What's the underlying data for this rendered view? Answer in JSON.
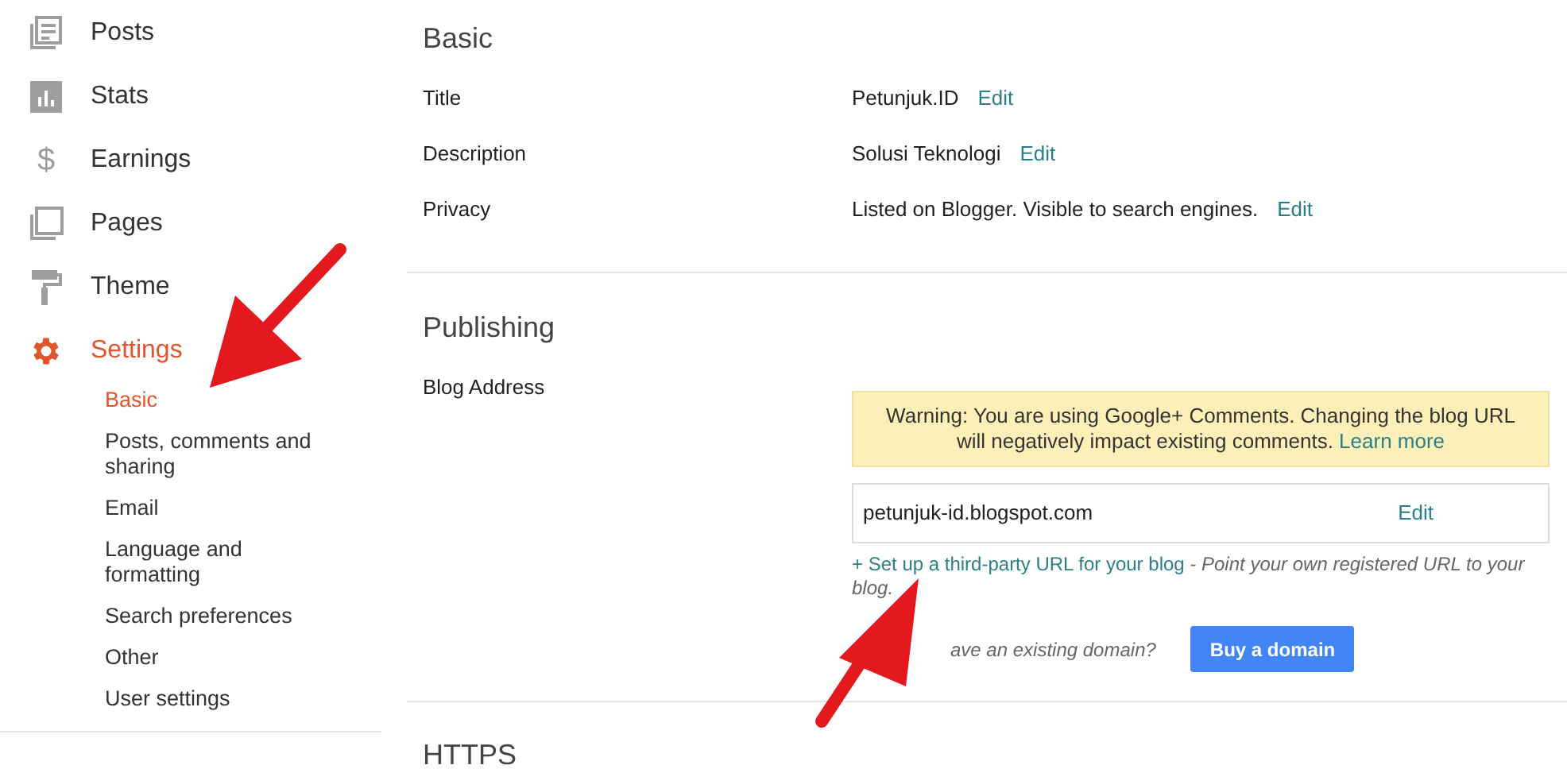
{
  "sidebar": {
    "items": [
      {
        "label": "Posts",
        "kind": "posts",
        "selected": false
      },
      {
        "label": "Stats",
        "kind": "stats",
        "selected": false
      },
      {
        "label": "Earnings",
        "kind": "earnings",
        "icon_text": "$",
        "selected": false
      },
      {
        "label": "Pages",
        "kind": "pages",
        "selected": false
      },
      {
        "label": "Theme",
        "kind": "theme",
        "selected": false
      },
      {
        "label": "Settings",
        "kind": "settings",
        "selected": true,
        "children": [
          {
            "label": "Basic",
            "selected": true
          },
          {
            "label": "Posts, comments and sharing",
            "selected": false
          },
          {
            "label": "Email",
            "selected": false
          },
          {
            "label": "Language and formatting",
            "selected": false
          },
          {
            "label": "Search preferences",
            "selected": false
          },
          {
            "label": "Other",
            "selected": false
          },
          {
            "label": "User settings",
            "selected": false
          }
        ]
      }
    ]
  },
  "basic": {
    "heading": "Basic",
    "rows": [
      {
        "label": "Title",
        "value": "Petunjuk.ID",
        "action": "Edit"
      },
      {
        "label": "Description",
        "value": "Solusi Teknologi",
        "action": "Edit"
      },
      {
        "label": "Privacy",
        "value": "Listed on Blogger. Visible to search engines.",
        "action": "Edit"
      }
    ]
  },
  "publishing": {
    "heading": "Publishing",
    "label": "Blog Address",
    "warning": {
      "text": "Warning: You are using Google+ Comments. Changing the blog URL will negatively impact existing comments.",
      "link": "Learn more"
    },
    "address": {
      "value": "petunjuk-id.blogspot.com",
      "action": "Edit"
    },
    "third_party": {
      "link": "+ Set up a third-party URL for your blog",
      "hint": "- Point your own registered URL to your blog."
    },
    "domain_question": "ave an existing domain?",
    "buy_button": "Buy a domain"
  },
  "https": {
    "heading": "HTTPS"
  }
}
